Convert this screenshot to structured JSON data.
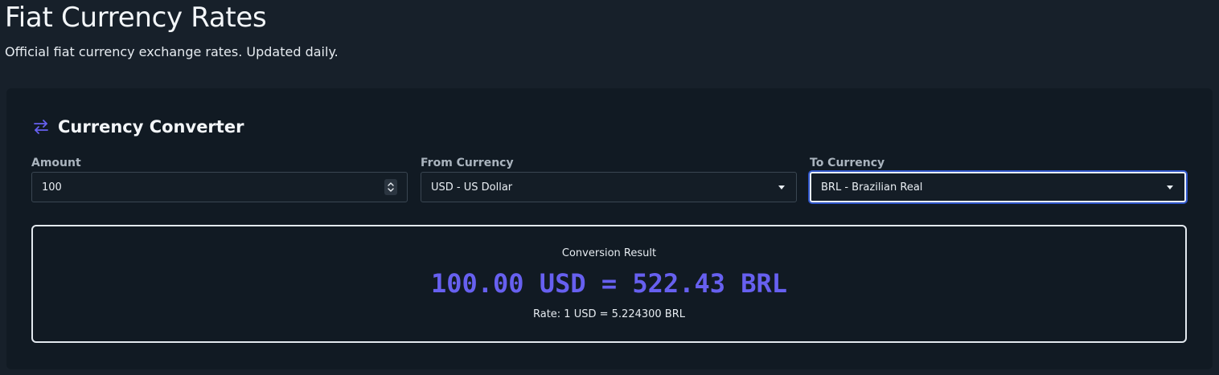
{
  "header": {
    "title": "Fiat Currency Rates",
    "subtitle": "Official fiat currency exchange rates. Updated daily."
  },
  "converter": {
    "title": "Currency Converter",
    "icon": "swap-arrows-icon",
    "accent_color": "#6760f0",
    "amount": {
      "label": "Amount",
      "value": "100"
    },
    "from_currency": {
      "label": "From Currency",
      "selected": "USD - US Dollar"
    },
    "to_currency": {
      "label": "To Currency",
      "selected": "BRL - Brazilian Real"
    },
    "result": {
      "label": "Conversion Result",
      "value": "100.00 USD = 522.43 BRL",
      "rate": "Rate: 1 USD = 5.224300 BRL"
    }
  }
}
